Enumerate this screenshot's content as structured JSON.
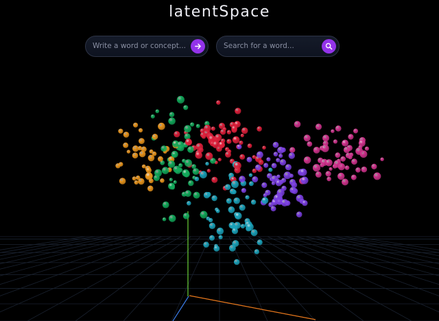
{
  "app": {
    "title": "latentSpace"
  },
  "concept_input": {
    "placeholder": "Write a word or concept...",
    "button_icon": "arrow-right-icon"
  },
  "search_input": {
    "placeholder": "Search for a word...",
    "button_icon": "search-icon"
  },
  "colors": {
    "background": "#000000",
    "accent": "#9333ea",
    "cluster_green": "#12a85a",
    "cluster_orange": "#e8941c",
    "cluster_red": "#dc1f3a",
    "cluster_cyan": "#1aa0b8",
    "cluster_purple": "#7a3fe0",
    "cluster_magenta": "#d0338d",
    "axis_x": "#e8781c",
    "axis_y": "#6ad03a",
    "axis_z": "#3a7be8",
    "grid": "#1a2230"
  }
}
